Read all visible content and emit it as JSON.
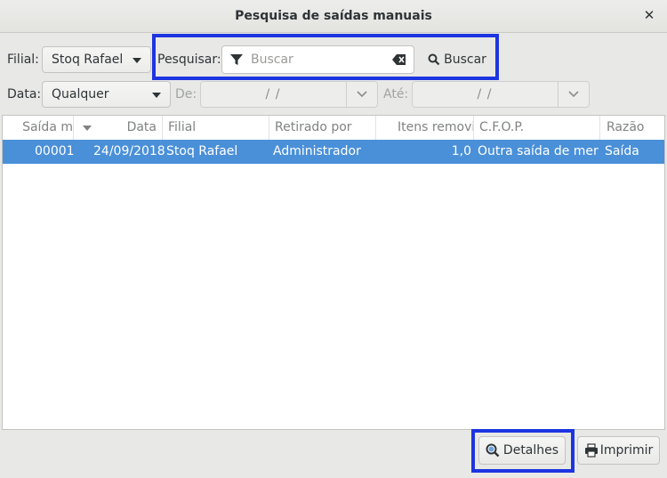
{
  "window": {
    "title": "Pesquisa de saídas manuais"
  },
  "filters": {
    "filial_label": "Filial:",
    "filial_value": "Stoq Rafael",
    "pesquisar_label": "Pesquisar:",
    "search_placeholder": "Buscar",
    "search_value": "",
    "buscar_label": "Buscar",
    "data_label": "Data:",
    "data_value": "Qualquer",
    "de_label": "De:",
    "de_value": "  /  /",
    "ate_label": "Até:",
    "ate_value": "  /  /"
  },
  "table": {
    "columns": [
      "Saída m",
      "Data",
      "Filial",
      "Retirado por",
      "Itens removid",
      "C.F.O.P.",
      "Razão"
    ],
    "rows": [
      {
        "numero": "00001",
        "data": "24/09/2018",
        "filial": "Stoq Rafael",
        "retirado_por": "Administrador",
        "itens": "1,0",
        "cfop": "Outra saída de mer...",
        "razao": "Saída"
      }
    ]
  },
  "actions": {
    "detalhes_label": "Detalhes",
    "imprimir_label": "Imprimir"
  },
  "colors": {
    "accent": "#4a90d9",
    "highlight": "#1d35e0"
  }
}
